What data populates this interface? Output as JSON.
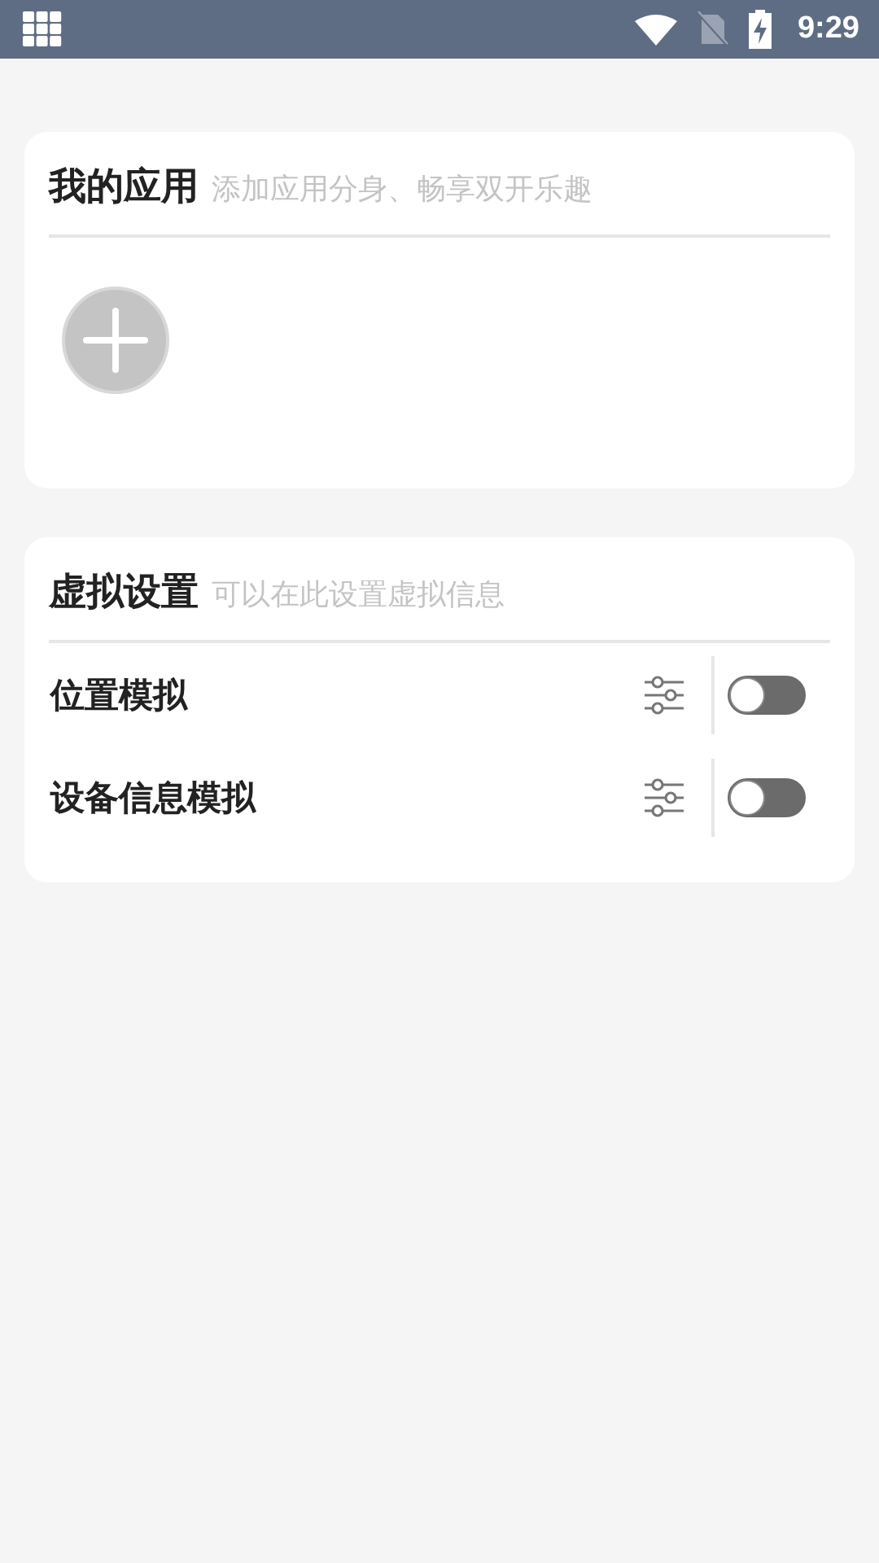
{
  "status_bar": {
    "time": "9:29"
  },
  "apps_card": {
    "title": "我的应用",
    "subtitle": "添加应用分身、畅享双开乐趣"
  },
  "virtual_card": {
    "title": "虚拟设置",
    "subtitle": "可以在此设置虚拟信息",
    "rows": [
      {
        "label": "位置模拟",
        "on": false
      },
      {
        "label": "设备信息模拟",
        "on": false
      }
    ]
  }
}
